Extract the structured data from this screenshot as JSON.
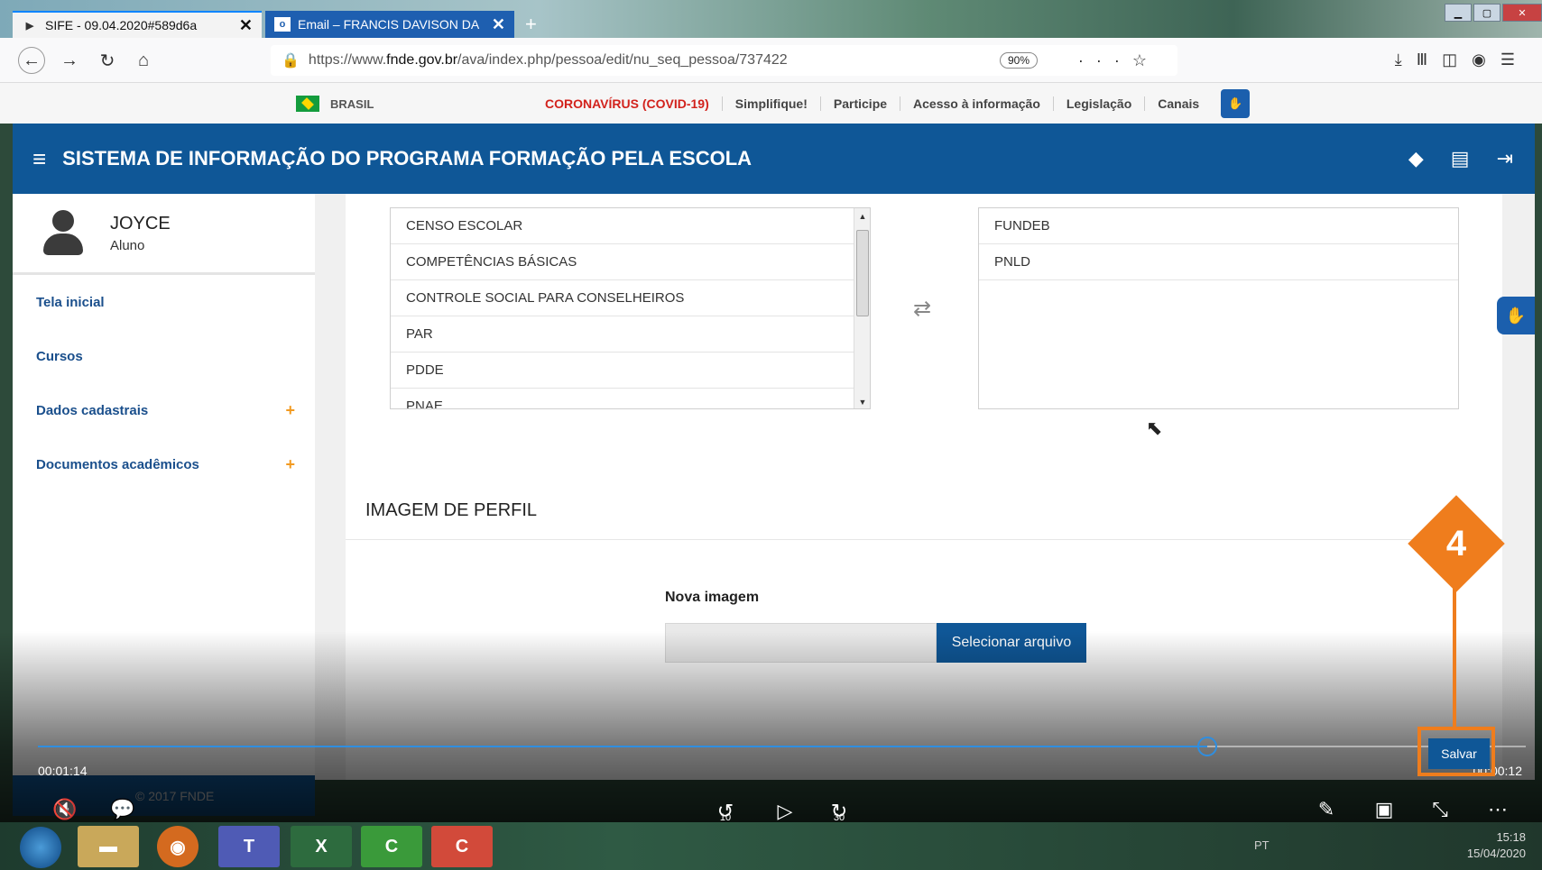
{
  "browser": {
    "tabs": [
      {
        "title": "SIFE - 09.04.2020#589d6a",
        "active": true
      },
      {
        "title": "Email – FRANCIS DAVISON DA",
        "active": false
      }
    ],
    "url_prefix": "https://www.",
    "url_domain": "fnde.gov.br",
    "url_path": "/ava/index.php/pessoa/edit/nu_seq_pessoa/737422",
    "zoom": "90%"
  },
  "govbar": {
    "brasil": "BRASIL",
    "links": [
      "CORONAVÍRUS (COVID-19)",
      "Simplifique!",
      "Participe",
      "Acesso à informação",
      "Legislação",
      "Canais"
    ]
  },
  "header": {
    "title": "SISTEMA DE INFORMAÇÃO DO PROGRAMA FORMAÇÃO PELA ESCOLA"
  },
  "sidebar": {
    "user_name": "JOYCE",
    "user_role": "Aluno",
    "items": [
      {
        "label": "Tela inicial",
        "expandable": false
      },
      {
        "label": "Cursos",
        "expandable": false
      },
      {
        "label": "Dados cadastrais",
        "expandable": true
      },
      {
        "label": "Documentos acadêmicos",
        "expandable": true
      }
    ],
    "footer": "© 2017 FNDE"
  },
  "main": {
    "available_list": [
      "CENSO ESCOLAR",
      "COMPETÊNCIAS BÁSICAS",
      "CONTROLE SOCIAL PARA CONSELHEIROS",
      "PAR",
      "PDDE",
      "PNAE"
    ],
    "selected_list": [
      "FUNDEB",
      "PNLD"
    ],
    "section_title": "IMAGEM DE PERFIL",
    "nova_imagem_label": "Nova imagem",
    "select_file_button": "Selecionar arquivo",
    "save_button": "Salvar"
  },
  "callout": {
    "number": "4",
    "color": "#ef7d1d"
  },
  "video": {
    "current_time": "00:01:14",
    "total_time": "00:00:12",
    "progress": 0.786,
    "rewind_label": "10",
    "forward_label": "30"
  },
  "taskbar": {
    "lang": "PT",
    "time": "15:18",
    "date": "15/04/2020"
  },
  "colors": {
    "brand_blue": "#0f5797",
    "accent_orange": "#f29a21",
    "covid_red": "#d2221c"
  }
}
